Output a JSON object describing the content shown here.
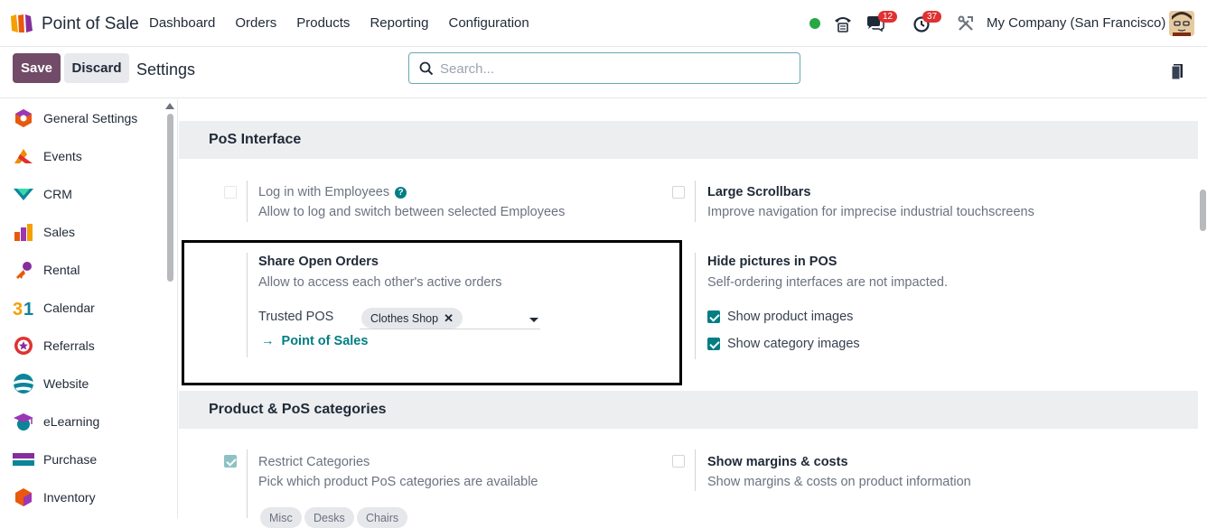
{
  "topbar": {
    "app_name": "Point of Sale",
    "menu": [
      "Dashboard",
      "Orders",
      "Products",
      "Reporting",
      "Configuration"
    ],
    "chat_badge": "12",
    "activity_badge": "37",
    "company": "My Company (San Francisco)"
  },
  "control_panel": {
    "save_label": "Save",
    "discard_label": "Discard",
    "title": "Settings",
    "search_placeholder": "Search..."
  },
  "sidebar": {
    "items": [
      {
        "label": "General Settings",
        "icon": "general-settings-icon"
      },
      {
        "label": "Events",
        "icon": "events-icon"
      },
      {
        "label": "CRM",
        "icon": "crm-icon"
      },
      {
        "label": "Sales",
        "icon": "sales-icon"
      },
      {
        "label": "Rental",
        "icon": "rental-icon"
      },
      {
        "label": "Calendar",
        "icon": "calendar-icon"
      },
      {
        "label": "Referrals",
        "icon": "referrals-icon"
      },
      {
        "label": "Website",
        "icon": "website-icon"
      },
      {
        "label": "eLearning",
        "icon": "elearning-icon"
      },
      {
        "label": "Purchase",
        "icon": "purchase-icon"
      },
      {
        "label": "Inventory",
        "icon": "inventory-icon"
      }
    ]
  },
  "sections": {
    "pos_interface": {
      "title": "PoS Interface",
      "login_employees": {
        "title": "Log in with Employees",
        "desc": "Allow to log and switch between selected Employees",
        "checked": false
      },
      "large_scrollbars": {
        "title": "Large Scrollbars",
        "desc": "Improve navigation for imprecise industrial touchscreens",
        "checked": false
      },
      "share_open_orders": {
        "title": "Share Open Orders",
        "desc": "Allow to access each other's active orders",
        "trusted_label": "Trusted POS",
        "trusted_tag": "Clothes Shop",
        "link": "Point of Sales"
      },
      "hide_pictures": {
        "title": "Hide pictures in POS",
        "desc": "Self-ordering interfaces are not impacted.",
        "opt1": "Show product images",
        "opt2": "Show category images"
      }
    },
    "product_categories": {
      "title": "Product & PoS categories",
      "restrict": {
        "title": "Restrict Categories",
        "desc": "Pick which product PoS categories are available",
        "checked": true,
        "tags": [
          "Misc",
          "Desks",
          "Chairs"
        ]
      },
      "margins": {
        "title": "Show margins & costs",
        "desc": "Show margins & costs on product information",
        "checked": false
      }
    }
  }
}
